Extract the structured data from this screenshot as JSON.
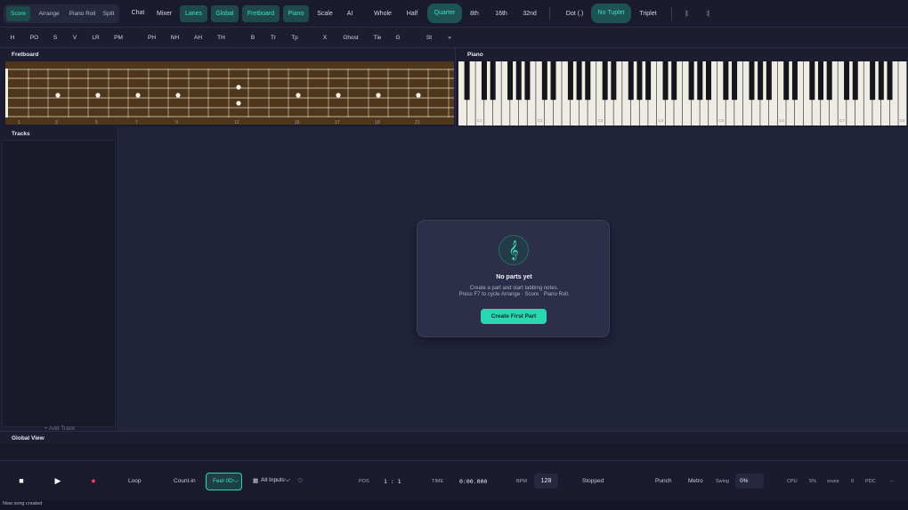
{
  "toolbar": {
    "view_modes": [
      "Score",
      "Arrange",
      "Piano Roll",
      "Split"
    ],
    "chat": "Chat",
    "mixer": "Mixer",
    "lanes": "Lanes",
    "global": "Global",
    "fretboard": "Fretboard",
    "piano": "Piano",
    "scale": "Scale",
    "ai": "AI",
    "durations": [
      "Whole",
      "Half",
      "Quarter",
      "8th",
      "16th",
      "32nd"
    ],
    "dot": "Dot (.)",
    "no_tuplet": "No Tuplet",
    "triplet": "Triplet",
    "repeat_start": "|:",
    "repeat_end": ":|"
  },
  "techniques": [
    "H",
    "PO",
    "S",
    "V",
    "LR",
    "PM",
    "PH",
    "NH",
    "AH",
    "TH",
    "B",
    "Tr",
    "Tp",
    "X",
    "Ghost",
    "Tie",
    "G",
    "St",
    "»"
  ],
  "fretboard": {
    "title": "Fretboard",
    "fret_numbers": [
      "3",
      "5",
      "7",
      "9",
      "12",
      "15",
      "17",
      "19",
      "21"
    ]
  },
  "piano": {
    "title": "Piano",
    "octave_labels": [
      "C1",
      "C2",
      "C3",
      "C4",
      "C5",
      "C6",
      "C7",
      "C8"
    ]
  },
  "tracks": {
    "title": "Tracks",
    "add_track": "+ Add Track"
  },
  "empty_state": {
    "clef": "𝄞",
    "title": "No parts yet",
    "line1": "Create a part and start tabbing notes.",
    "line2": "Press F7 to cycle Arrange · Score · Piano Roll.",
    "button": "Create First Part"
  },
  "global_view": {
    "title": "Global View"
  },
  "transport": {
    "stop_icon": "■",
    "play_icon": "▶",
    "record_icon": "●",
    "record_color": "#ff3b5c",
    "loop": "Loop",
    "count_in": "Count-in",
    "feel": "Feel 0D",
    "inputs": "All Inputs",
    "pos_label": "POS",
    "pos_value": "1 : 1",
    "time_label": "TIME",
    "time_value": "0:00.000",
    "bpm_label": "BPM",
    "bpm_value": "128",
    "state": "Stopped",
    "punch": "Punch",
    "metro": "Metro",
    "swing_label": "Swing",
    "swing_value": "0%",
    "cpu_label": "CPU",
    "cpu_value": "5%",
    "xruns_label": "xruns",
    "xruns_value": "0",
    "pdc_label": "PDC",
    "pdc_value": "--"
  },
  "status": "New song created",
  "colors": {
    "accent": "#3fe0c2",
    "accent_button": "#2ad7b3",
    "fretboard_wood": "#4f3519"
  }
}
